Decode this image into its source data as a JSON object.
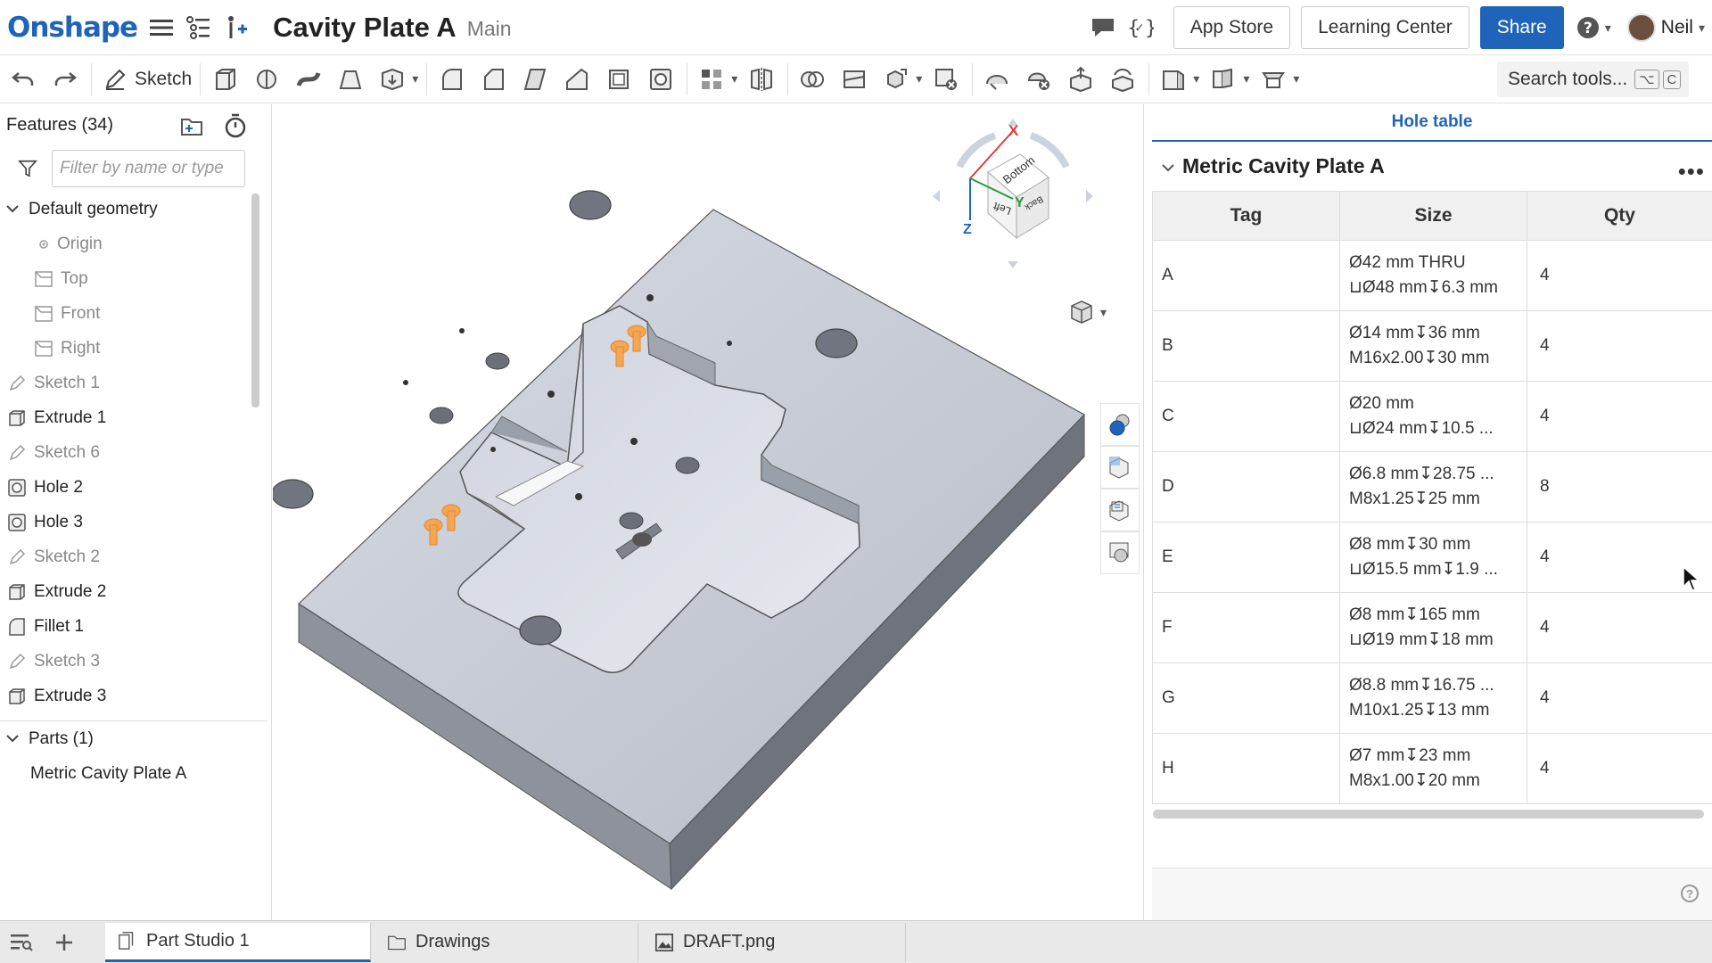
{
  "header": {
    "logo": "Onshape",
    "doc_title": "Cavity Plate A",
    "branch": "Main",
    "buttons": {
      "app_store": "App Store",
      "learning_center": "Learning Center",
      "share": "Share"
    },
    "user": "Neil",
    "icons": [
      "menu-icon",
      "feature-list-icon",
      "insert-icon",
      "comment-icon",
      "variables-icon",
      "help-icon"
    ]
  },
  "toolbar": {
    "sketch_label": "Sketch",
    "search_label": "Search tools...",
    "search_shortcut_1": "⌥",
    "search_shortcut_2": "C"
  },
  "features": {
    "header": "Features (34)",
    "filter_placeholder": "Filter by name or type",
    "default_geometry": "Default geometry",
    "geometry_items": [
      "Origin",
      "Top",
      "Front",
      "Right"
    ],
    "items": [
      {
        "label": "Sketch 1",
        "icon": "sketch-icon"
      },
      {
        "label": "Extrude 1",
        "icon": "extrude-icon"
      },
      {
        "label": "Sketch 6",
        "icon": "sketch-icon"
      },
      {
        "label": "Hole 2",
        "icon": "hole-icon"
      },
      {
        "label": "Hole 3",
        "icon": "hole-icon"
      },
      {
        "label": "Sketch 2",
        "icon": "sketch-icon"
      },
      {
        "label": "Extrude 2",
        "icon": "extrude-icon"
      },
      {
        "label": "Fillet 1",
        "icon": "fillet-icon"
      },
      {
        "label": "Sketch 3",
        "icon": "sketch-icon"
      },
      {
        "label": "Extrude 3",
        "icon": "extrude-icon"
      }
    ],
    "parts_header": "Parts (1)",
    "parts": [
      "Metric Cavity Plate A"
    ]
  },
  "viewcube": {
    "x": "X",
    "y": "Y",
    "z": "Z",
    "face_top": "Bottom",
    "face_left": "Left",
    "face_right": "Back"
  },
  "hole_table": {
    "tab": "Hole table",
    "part_name": "Metric Cavity Plate A",
    "columns": [
      "Tag",
      "Size",
      "Qty"
    ],
    "rows": [
      {
        "tag": "A",
        "size1": "Ø42 mm THRU",
        "size2": "⊔Ø48 mm↧6.3 mm",
        "qty": "4"
      },
      {
        "tag": "B",
        "size1": "Ø14 mm↧36 mm",
        "size2": "M16x2.00↧30 mm",
        "qty": "4"
      },
      {
        "tag": "C",
        "size1": "Ø20 mm",
        "size2": "⊔Ø24 mm↧10.5 ...",
        "qty": "4"
      },
      {
        "tag": "D",
        "size1": "Ø6.8 mm↧28.75 ...",
        "size2": "M8x1.25↧25 mm",
        "qty": "8"
      },
      {
        "tag": "E",
        "size1": "Ø8 mm↧30 mm",
        "size2": "⊔Ø15.5 mm↧1.9 ...",
        "qty": "4"
      },
      {
        "tag": "F",
        "size1": "Ø8 mm↧165 mm",
        "size2": "⊔Ø19 mm↧18 mm",
        "qty": "4"
      },
      {
        "tag": "G",
        "size1": "Ø8.8 mm↧16.75 ...",
        "size2": "M10x1.25↧13 mm",
        "qty": "4"
      },
      {
        "tag": "H",
        "size1": "Ø7 mm↧23 mm",
        "size2": "M8x1.00↧20 mm",
        "qty": "4"
      }
    ]
  },
  "bottom_tabs": [
    {
      "label": "Part Studio 1",
      "icon": "part-studio-icon",
      "active": true
    },
    {
      "label": "Drawings",
      "icon": "folder-icon",
      "active": false
    },
    {
      "label": "DRAFT.png",
      "icon": "image-icon",
      "active": false
    }
  ],
  "colors": {
    "accent": "#1f64b8",
    "part_top": "#c9ced8",
    "part_side": "#7d828b",
    "highlight": "#f4a653"
  }
}
